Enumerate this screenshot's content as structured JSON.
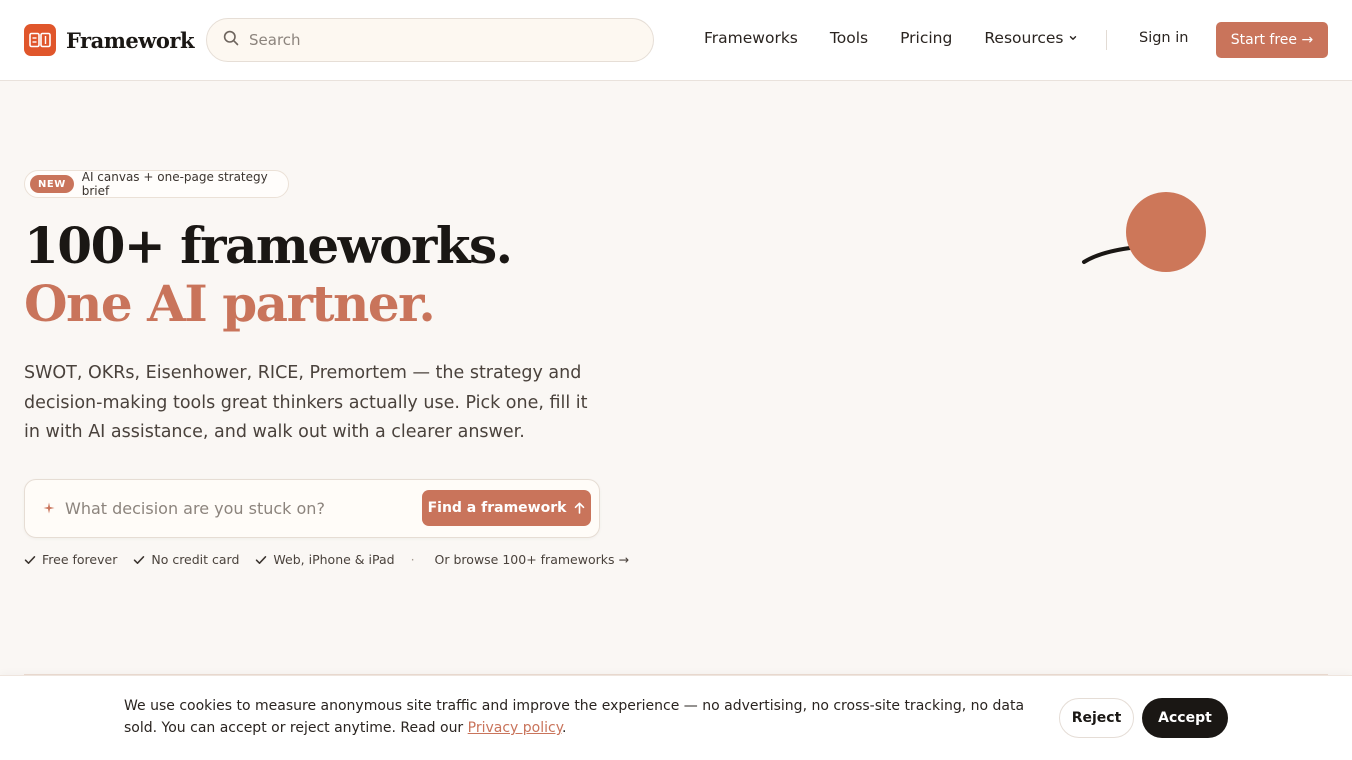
{
  "brand": {
    "name": "Framework",
    "logo_icon": "framework-logo-icon",
    "accent_color": "#c9745b",
    "logo_color": "#e0562b"
  },
  "header": {
    "search_placeholder": "Search",
    "nav": [
      {
        "label": "Frameworks"
      },
      {
        "label": "Tools"
      },
      {
        "label": "Pricing"
      },
      {
        "label": "Resources",
        "has_dropdown": true
      }
    ],
    "sign_in": "Sign in",
    "start_free": "Start free →"
  },
  "hero": {
    "badge_tag": "NEW",
    "badge_text": "AI canvas + one-page strategy brief",
    "title_line1": "100+ frameworks.",
    "title_line2": "One AI partner.",
    "description": "SWOT, OKRs, Eisenhower, RICE, Premortem — the strategy and decision-making tools great thinkers actually use. Pick one, fill it in with AI assistance, and walk out with a clearer answer.",
    "ask_placeholder": "What decision are you stuck on?",
    "find_button": "Find a framework",
    "perks": [
      "Free forever",
      "No credit card",
      "Web, iPhone & iPad"
    ],
    "separator": "·",
    "browse_link": "Or browse 100+ frameworks →"
  },
  "cookie": {
    "text": "We use cookies to measure anonymous site traffic and improve the experience — no advertising, no cross-site tracking, no data sold. You can accept or reject anytime. Read our",
    "link": "Privacy policy",
    "after_link": ".",
    "reject": "Reject",
    "accept": "Accept"
  }
}
